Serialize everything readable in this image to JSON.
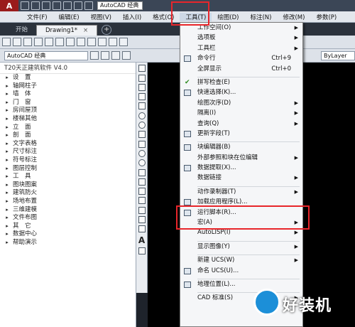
{
  "window": {
    "title": "AutoCAD 经典"
  },
  "menubar": {
    "items": [
      "文件(F)",
      "编辑(E)",
      "视图(V)",
      "插入(I)",
      "格式(O)",
      "工具(T)",
      "绘图(D)",
      "标注(N)",
      "修改(M)",
      "参数(P)"
    ],
    "active": "工具(T)"
  },
  "tabs": {
    "items": [
      "开始",
      "Drawing1*"
    ],
    "active": "Drawing1*",
    "close_glyph": "×"
  },
  "toolbar": {
    "workspace_combo": "AutoCAD 经典",
    "layer_combo": "ByLayer"
  },
  "t20_panel": {
    "title": "T20天正建筑软件 V4.0",
    "items": [
      "设　置",
      "轴网柱子",
      "墙　体",
      "门　窗",
      "房间屋顶",
      "楼梯其他",
      "立　面",
      "剖　面",
      "文字表格",
      "尺寸标注",
      "符号标注",
      "图层控制",
      "工　具",
      "图块图案",
      "建筑防火",
      "场地布置",
      "三维建模",
      "文件布图",
      "其　它",
      "数据中心",
      "帮助演示"
    ]
  },
  "tools_menu": {
    "items": [
      {
        "label": "工作空间(O)",
        "submenu": true
      },
      {
        "label": "选项板",
        "submenu": true
      },
      {
        "label": "工具栏",
        "submenu": true
      },
      {
        "label": "命令行",
        "shortcut": "Ctrl+9",
        "icon": "command-line-icon"
      },
      {
        "label": "全屏显示",
        "shortcut": "Ctrl+0"
      },
      {
        "separator": true
      },
      {
        "label": "拼写检查(E)",
        "checked": true
      },
      {
        "label": "快速选择(K)...",
        "icon": "quick-select-icon"
      },
      {
        "label": "绘图次序(D)",
        "submenu": true
      },
      {
        "label": "隔离(I)",
        "submenu": true
      },
      {
        "label": "查询(Q)",
        "submenu": true
      },
      {
        "label": "更新字段(T)",
        "icon": "update-field-icon"
      },
      {
        "separator": true
      },
      {
        "label": "块编辑器(B)",
        "icon": "block-editor-icon"
      },
      {
        "label": "外部参照和块在位编辑",
        "submenu": true
      },
      {
        "label": "数据提取(X)...",
        "icon": "data-extract-icon"
      },
      {
        "label": "数据链接",
        "submenu": true
      },
      {
        "separator": true
      },
      {
        "label": "动作录制器(T)",
        "submenu": true
      },
      {
        "label": "加载应用程序(L)...",
        "icon": "load-app-icon",
        "highlighted": true
      },
      {
        "label": "运行脚本(R)...",
        "icon": "run-script-icon"
      },
      {
        "label": "宏(A)",
        "submenu": true
      },
      {
        "label": "AutoLISP(I)",
        "submenu": true
      },
      {
        "separator": true
      },
      {
        "label": "显示图像(Y)",
        "submenu": true
      },
      {
        "separator": true
      },
      {
        "label": "新建 UCS(W)",
        "submenu": true
      },
      {
        "label": "命名 UCS(U)...",
        "icon": "named-ucs-icon"
      },
      {
        "separator": true
      },
      {
        "label": "地理位置(L)...",
        "icon": "geolocation-icon"
      },
      {
        "separator": true
      },
      {
        "label": "CAD 标准(S)",
        "submenu": true
      }
    ]
  },
  "watermark": {
    "text": "好装机"
  },
  "colors": {
    "annotation_red": "#e8262b",
    "menu_bg": "#f5f6f8",
    "canvas": "#000000"
  }
}
